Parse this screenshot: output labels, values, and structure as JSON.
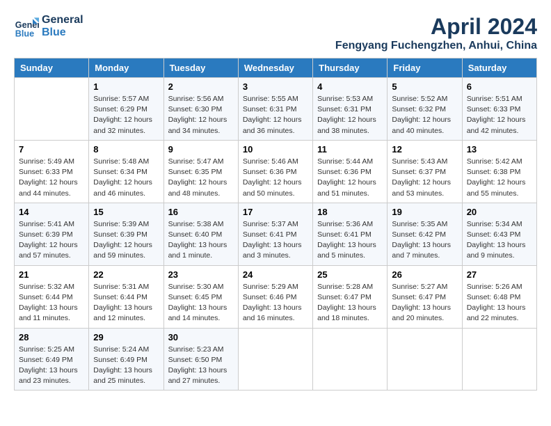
{
  "logo": {
    "line1": "General",
    "line2": "Blue"
  },
  "title": "April 2024",
  "location": "Fengyang Fuchengzhen, Anhui, China",
  "days_header": [
    "Sunday",
    "Monday",
    "Tuesday",
    "Wednesday",
    "Thursday",
    "Friday",
    "Saturday"
  ],
  "weeks": [
    [
      {
        "num": "",
        "info": ""
      },
      {
        "num": "1",
        "info": "Sunrise: 5:57 AM\nSunset: 6:29 PM\nDaylight: 12 hours\nand 32 minutes."
      },
      {
        "num": "2",
        "info": "Sunrise: 5:56 AM\nSunset: 6:30 PM\nDaylight: 12 hours\nand 34 minutes."
      },
      {
        "num": "3",
        "info": "Sunrise: 5:55 AM\nSunset: 6:31 PM\nDaylight: 12 hours\nand 36 minutes."
      },
      {
        "num": "4",
        "info": "Sunrise: 5:53 AM\nSunset: 6:31 PM\nDaylight: 12 hours\nand 38 minutes."
      },
      {
        "num": "5",
        "info": "Sunrise: 5:52 AM\nSunset: 6:32 PM\nDaylight: 12 hours\nand 40 minutes."
      },
      {
        "num": "6",
        "info": "Sunrise: 5:51 AM\nSunset: 6:33 PM\nDaylight: 12 hours\nand 42 minutes."
      }
    ],
    [
      {
        "num": "7",
        "info": "Sunrise: 5:49 AM\nSunset: 6:33 PM\nDaylight: 12 hours\nand 44 minutes."
      },
      {
        "num": "8",
        "info": "Sunrise: 5:48 AM\nSunset: 6:34 PM\nDaylight: 12 hours\nand 46 minutes."
      },
      {
        "num": "9",
        "info": "Sunrise: 5:47 AM\nSunset: 6:35 PM\nDaylight: 12 hours\nand 48 minutes."
      },
      {
        "num": "10",
        "info": "Sunrise: 5:46 AM\nSunset: 6:36 PM\nDaylight: 12 hours\nand 50 minutes."
      },
      {
        "num": "11",
        "info": "Sunrise: 5:44 AM\nSunset: 6:36 PM\nDaylight: 12 hours\nand 51 minutes."
      },
      {
        "num": "12",
        "info": "Sunrise: 5:43 AM\nSunset: 6:37 PM\nDaylight: 12 hours\nand 53 minutes."
      },
      {
        "num": "13",
        "info": "Sunrise: 5:42 AM\nSunset: 6:38 PM\nDaylight: 12 hours\nand 55 minutes."
      }
    ],
    [
      {
        "num": "14",
        "info": "Sunrise: 5:41 AM\nSunset: 6:39 PM\nDaylight: 12 hours\nand 57 minutes."
      },
      {
        "num": "15",
        "info": "Sunrise: 5:39 AM\nSunset: 6:39 PM\nDaylight: 12 hours\nand 59 minutes."
      },
      {
        "num": "16",
        "info": "Sunrise: 5:38 AM\nSunset: 6:40 PM\nDaylight: 13 hours\nand 1 minute."
      },
      {
        "num": "17",
        "info": "Sunrise: 5:37 AM\nSunset: 6:41 PM\nDaylight: 13 hours\nand 3 minutes."
      },
      {
        "num": "18",
        "info": "Sunrise: 5:36 AM\nSunset: 6:41 PM\nDaylight: 13 hours\nand 5 minutes."
      },
      {
        "num": "19",
        "info": "Sunrise: 5:35 AM\nSunset: 6:42 PM\nDaylight: 13 hours\nand 7 minutes."
      },
      {
        "num": "20",
        "info": "Sunrise: 5:34 AM\nSunset: 6:43 PM\nDaylight: 13 hours\nand 9 minutes."
      }
    ],
    [
      {
        "num": "21",
        "info": "Sunrise: 5:32 AM\nSunset: 6:44 PM\nDaylight: 13 hours\nand 11 minutes."
      },
      {
        "num": "22",
        "info": "Sunrise: 5:31 AM\nSunset: 6:44 PM\nDaylight: 13 hours\nand 12 minutes."
      },
      {
        "num": "23",
        "info": "Sunrise: 5:30 AM\nSunset: 6:45 PM\nDaylight: 13 hours\nand 14 minutes."
      },
      {
        "num": "24",
        "info": "Sunrise: 5:29 AM\nSunset: 6:46 PM\nDaylight: 13 hours\nand 16 minutes."
      },
      {
        "num": "25",
        "info": "Sunrise: 5:28 AM\nSunset: 6:47 PM\nDaylight: 13 hours\nand 18 minutes."
      },
      {
        "num": "26",
        "info": "Sunrise: 5:27 AM\nSunset: 6:47 PM\nDaylight: 13 hours\nand 20 minutes."
      },
      {
        "num": "27",
        "info": "Sunrise: 5:26 AM\nSunset: 6:48 PM\nDaylight: 13 hours\nand 22 minutes."
      }
    ],
    [
      {
        "num": "28",
        "info": "Sunrise: 5:25 AM\nSunset: 6:49 PM\nDaylight: 13 hours\nand 23 minutes."
      },
      {
        "num": "29",
        "info": "Sunrise: 5:24 AM\nSunset: 6:49 PM\nDaylight: 13 hours\nand 25 minutes."
      },
      {
        "num": "30",
        "info": "Sunrise: 5:23 AM\nSunset: 6:50 PM\nDaylight: 13 hours\nand 27 minutes."
      },
      {
        "num": "",
        "info": ""
      },
      {
        "num": "",
        "info": ""
      },
      {
        "num": "",
        "info": ""
      },
      {
        "num": "",
        "info": ""
      }
    ]
  ]
}
